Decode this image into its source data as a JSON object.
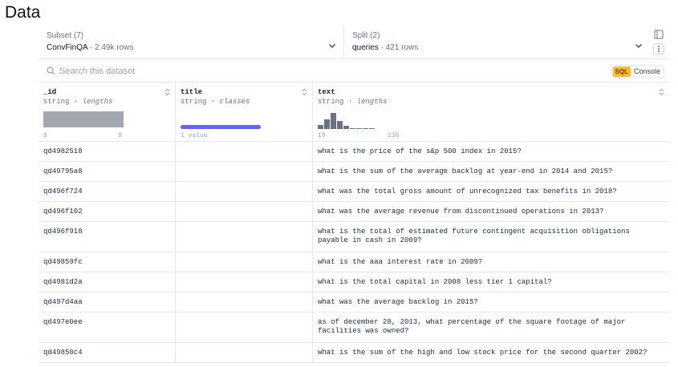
{
  "page": {
    "title": "Data"
  },
  "subset": {
    "label": "Subset (7)",
    "value": "ConvFinQA",
    "meta": "2.49k rows"
  },
  "split": {
    "label": "Split (2)",
    "value": "queries",
    "meta": "421 rows"
  },
  "search": {
    "placeholder": "Search this dataset"
  },
  "sql": {
    "badge": "SQL",
    "label": "Console"
  },
  "columns": [
    {
      "name": "_id",
      "type": "string",
      "stat": "lengths",
      "min": "9",
      "max": "9"
    },
    {
      "name": "title",
      "type": "string",
      "stat": "classes",
      "value_count": "1 value"
    },
    {
      "name": "text",
      "type": "string",
      "stat": "lengths",
      "min": "19",
      "max": "238",
      "histogram": [
        0.25,
        0.6,
        1.0,
        0.5,
        0.18,
        0.06,
        0.03,
        0.02,
        0.02
      ]
    }
  ],
  "colors": {
    "histogram_bar": "#6b7280",
    "class_bar": "#6366f1",
    "sql_badge": "#fbbf24"
  },
  "rows": [
    {
      "id": "qd4982518",
      "title": "",
      "text": "what is the price of the s&p 500 index in 2015?"
    },
    {
      "id": "qd49795a8",
      "title": "",
      "text": "what is the sum of the average backlog at year-end in 2014 and 2015?"
    },
    {
      "id": "qd496f724",
      "title": "",
      "text": "what was the total gross amount of unrecognized tax benefits in 2018?"
    },
    {
      "id": "qd496f102",
      "title": "",
      "text": "what was the average revenue from discontinued operations in 2013?"
    },
    {
      "id": "qd496f918",
      "title": "",
      "text": "what is the total of estimated future contingent acquisition obligations payable in cash in 2009?"
    },
    {
      "id": "qd49859fc",
      "title": "",
      "text": "what is the aaa interest rate in 2009?"
    },
    {
      "id": "qd4981d2a",
      "title": "",
      "text": "what is the total capital in 2008 less tier 1 capital?"
    },
    {
      "id": "qd497d4aa",
      "title": "",
      "text": "what was the average backlog in 2015?"
    },
    {
      "id": "qd497e0ee",
      "title": "",
      "text": "as of december 28, 2013, what percentage of the square footage of major facilities was owned?"
    },
    {
      "id": "qd49850c4",
      "title": "",
      "text": "what is the sum of the high and low stock price for the second quarter 2002?"
    }
  ]
}
